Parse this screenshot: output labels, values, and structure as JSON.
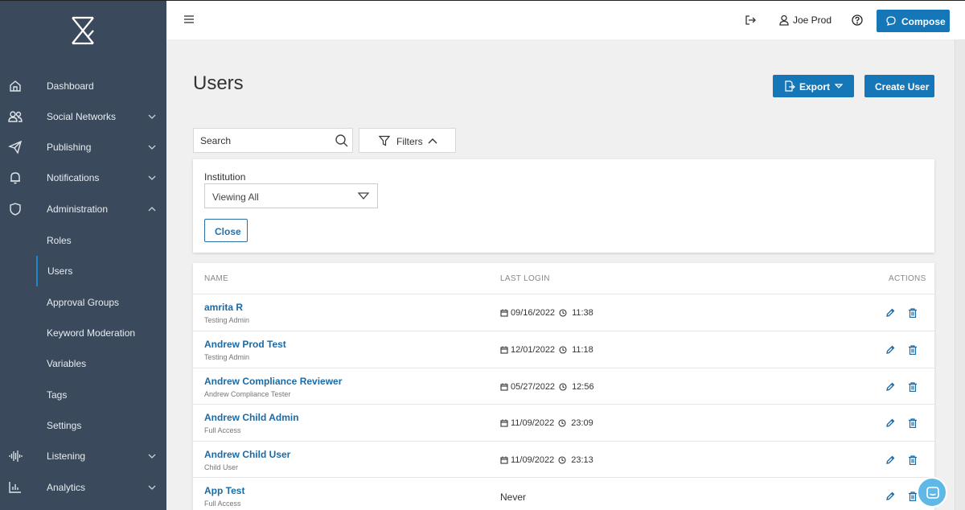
{
  "sidebar": {
    "items": [
      {
        "label": "Dashboard",
        "icon": "home-icon"
      },
      {
        "label": "Social Networks",
        "icon": "users-icon"
      },
      {
        "label": "Publishing",
        "icon": "paper-plane-icon"
      },
      {
        "label": "Notifications",
        "icon": "bell-icon"
      },
      {
        "label": "Administration",
        "icon": "shield-icon"
      }
    ],
    "sub_items": [
      "Roles",
      "Users",
      "Approval Groups",
      "Keyword Moderation",
      "Variables",
      "Tags",
      "Settings"
    ],
    "bottom_items": [
      {
        "label": "Listening",
        "icon": "waveform-icon"
      },
      {
        "label": "Analytics",
        "icon": "bar-chart-icon"
      }
    ],
    "active": "Users"
  },
  "topbar": {
    "user_name": "Joe Prod",
    "compose_label": "Compose"
  },
  "page": {
    "title": "Users",
    "export_label": "Export",
    "create_label": "Create User"
  },
  "search": {
    "placeholder": "Search"
  },
  "filters": {
    "label": "Filters",
    "institution_label": "Institution",
    "institution_value": "Viewing All",
    "close_label": "Close"
  },
  "table": {
    "headers": {
      "name": "NAME",
      "last_login": "LAST LOGIN",
      "actions": "ACTIONS"
    },
    "rows": [
      {
        "name": "amrita R",
        "role": "Testing Admin",
        "date": "09/16/2022",
        "time": "11:38"
      },
      {
        "name": "Andrew Prod Test",
        "role": "Testing Admin",
        "date": "12/01/2022",
        "time": "11:18"
      },
      {
        "name": "Andrew Compliance Reviewer",
        "role": "Andrew Compliance Tester",
        "date": "05/27/2022",
        "time": "12:56"
      },
      {
        "name": "Andrew Child Admin",
        "role": "Full Access",
        "date": "11/09/2022",
        "time": "23:09"
      },
      {
        "name": "Andrew Child User",
        "role": "Child User",
        "date": "11/09/2022",
        "time": "23:13"
      },
      {
        "name": "App Test",
        "role": "Full Access",
        "never": "Never"
      }
    ]
  },
  "colors": {
    "sidebar_bg": "#3a4a5c",
    "accent": "#1677b8",
    "link": "#1a6aa6"
  }
}
